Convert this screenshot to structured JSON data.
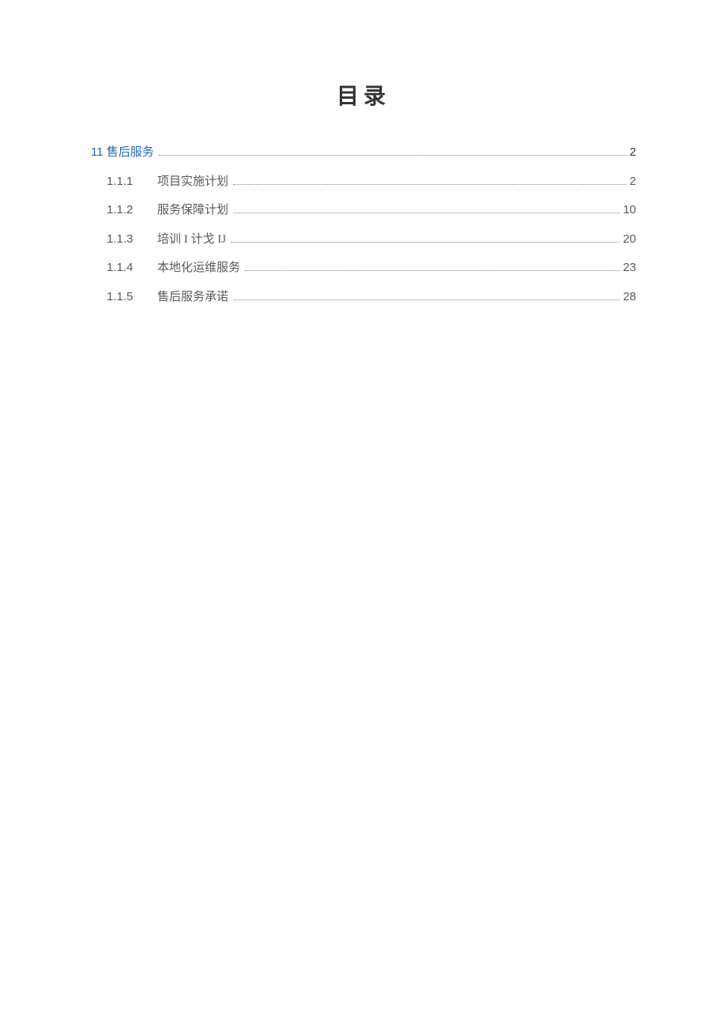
{
  "title": "目录",
  "toc": {
    "chapter": {
      "label": "11 售后服务",
      "page": "2"
    },
    "items": [
      {
        "number": "1.1.1",
        "label": "项目实施计划",
        "page": "2"
      },
      {
        "number": "1.1.2",
        "label": "服务保障计划",
        "page": "10"
      },
      {
        "number": "1.1.3",
        "label": "培训 I 计戈 IJ",
        "page": "20"
      },
      {
        "number": "1.1.4",
        "label": "本地化运维服务",
        "page": "23"
      },
      {
        "number": "1.1.5",
        "label": "售后服务承诺",
        "page": "28"
      }
    ]
  }
}
